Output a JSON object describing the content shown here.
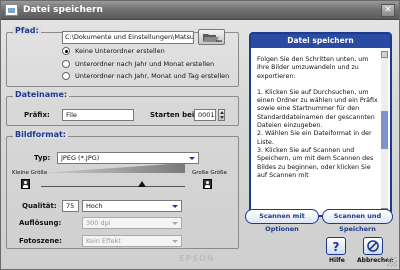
{
  "window": {
    "title": "Datei speichern",
    "close": "✕"
  },
  "pfad": {
    "title": "Pfad:",
    "path_value": "C:\\Dokumente und Einstellungen\\Matsu",
    "options": [
      {
        "label": "Keine Unterordner erstellen",
        "selected": true
      },
      {
        "label": "Unterordner nach Jahr und Monat erstellen",
        "selected": false
      },
      {
        "label": "Unterordner nach Jahr, Monat und Tag erstellen",
        "selected": false
      }
    ]
  },
  "dateiname": {
    "title": "Dateiname:",
    "prafix_label": "Präfix:",
    "prafix_value": "File",
    "starten_label": "Starten bei:",
    "starten_value": "0001"
  },
  "bildformat": {
    "title": "Bildformat:",
    "typ_label": "Typ:",
    "typ_value": "JPEG (*.JPG)",
    "klein_label": "Kleine Größe",
    "gross_label": "Große Größe",
    "slider_level": 0.7,
    "qualitat_label": "Qualität:",
    "qualitat_value": "75",
    "qualitat_option": "Hoch",
    "auflosung_label": "Auflösung:",
    "auflosung_value": "300 dpi",
    "fotoszene_label": "Fotoszene:",
    "fotoszene_value": "Kein Effekt"
  },
  "help": {
    "title": "Datei speichern",
    "intro": "Folgen Sie den Schritten unten, um Ihre Bilder umzuwandeln und zu exportieren:",
    "steps": "1. Klicken Sie auf Durchsuchen, um einen Ordner zu wählen und ein Präfix sowie eine Startnummer für den Standarddateinamen der gescannten Dateien einzugeben.\n2. Wählen Sie ein Dateiformat in der Liste.\n3. Klicken Sie auf Scannen und Speichern, um mit dem Scannen des Bildes zu beginnen, oder klicken Sie auf Scannen mit"
  },
  "buttons": {
    "scan_options": "Scannen mit Optionen",
    "scan_save": "Scannen und Speichern",
    "help": "Hilfe",
    "cancel": "Abbrechen"
  },
  "brand": "EPSON",
  "icons": {
    "folder": "folder-open-icon",
    "help": "question-mark-icon",
    "cancel": "cancel-icon",
    "person": "person-icon"
  },
  "colors": {
    "accent": "#1d3a8f",
    "header": "#2a4aa3"
  }
}
